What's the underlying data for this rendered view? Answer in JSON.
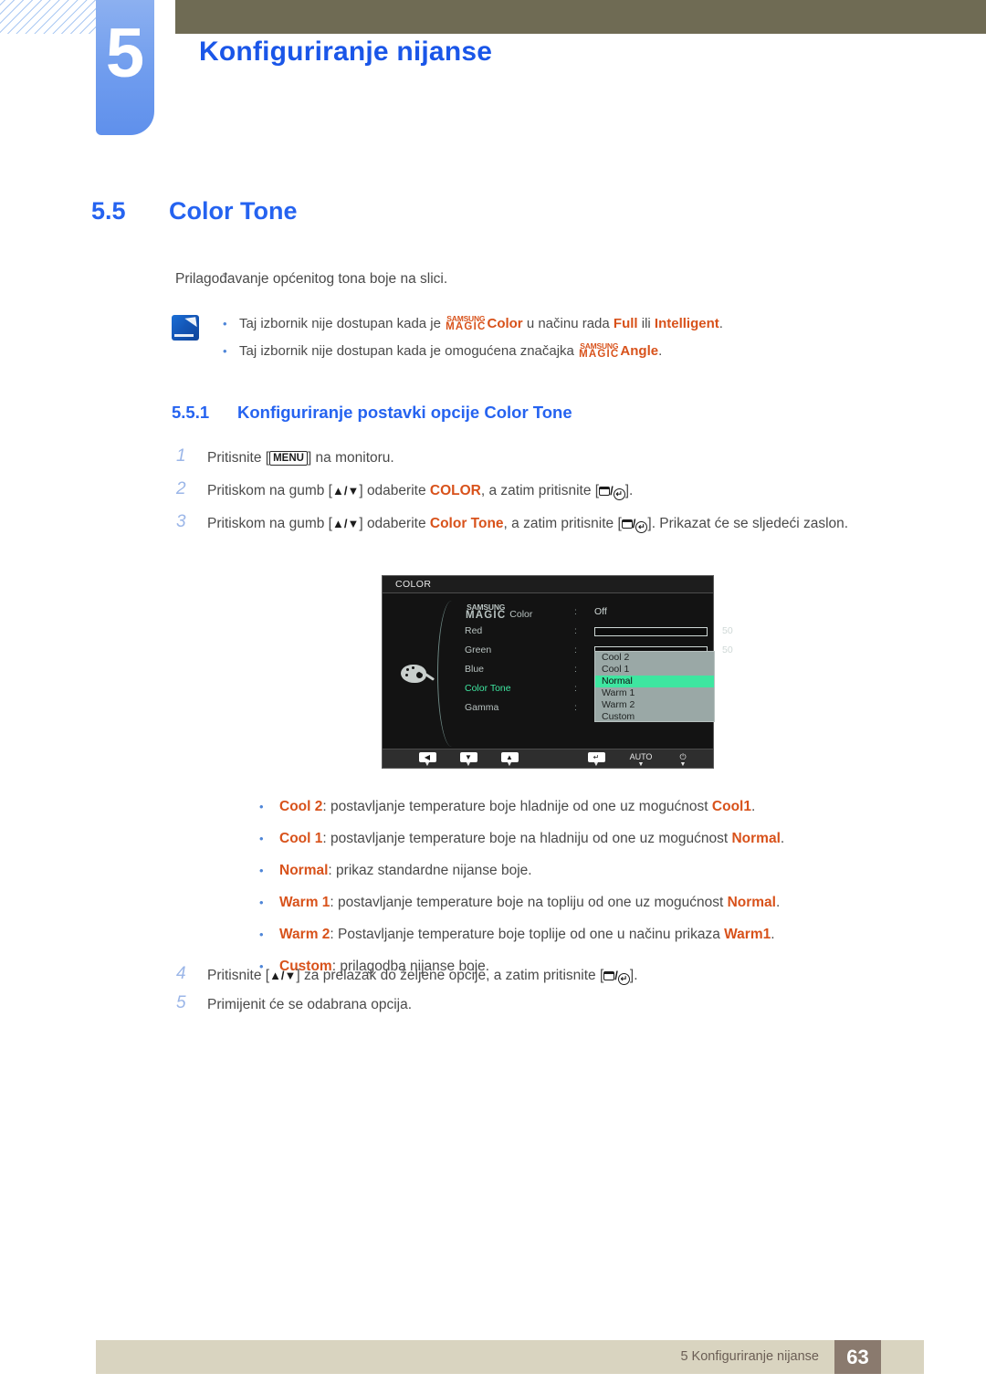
{
  "header": {
    "chapter_number": "5",
    "chapter_title": "Konfiguriranje nijanse"
  },
  "section": {
    "number": "5.5",
    "title": "Color Tone",
    "intro": "Prilagođavanje općenitog tona boje na slici."
  },
  "note": {
    "icon": "note-pencil-icon",
    "items": [
      {
        "pre": "Taj izbornik nije dostupan kada je ",
        "magic_top": "SAMSUNG",
        "magic_bottom": "MAGIC",
        "magic_word": "Color",
        "mid": " u načinu rada ",
        "hl1": "Full",
        "between": " ili ",
        "hl2": "Intelligent",
        "post": "."
      },
      {
        "pre": "Taj izbornik nije dostupan kada je omogućena značajka ",
        "magic_top": "SAMSUNG",
        "magic_bottom": "MAGIC",
        "magic_word": "Angle",
        "mid": "",
        "hl1": "",
        "between": "",
        "hl2": "",
        "post": "."
      }
    ]
  },
  "subsection": {
    "number": "5.5.1",
    "title": "Konfiguriranje postavki opcije Color Tone"
  },
  "steps": [
    {
      "n": "1",
      "p1": "Pritisnite [",
      "key": "MENU",
      "p2": "] na monitoru."
    },
    {
      "n": "2",
      "p1": "Pritiskom na gumb [",
      "arrows": "▲/▼",
      "p2": "] odaberite ",
      "hl": "COLOR",
      "p3": ", a zatim pritisnite [",
      "slash": "/",
      "p4": "]."
    },
    {
      "n": "3",
      "p1": "Pritiskom na gumb [",
      "arrows": "▲/▼",
      "p2": "] odaberite ",
      "hl": "Color Tone",
      "p3": ", a zatim pritisnite [",
      "slash": "/",
      "p4": "]. Prikazat će se sljedeći zaslon."
    }
  ],
  "steps_after": [
    {
      "n": "4",
      "p1": "Pritisnite [",
      "arrows": "▲/▼",
      "p2": "] za prelazak do željene opcije, a zatim pritisnite [",
      "slash": "/",
      "p4": "]."
    },
    {
      "n": "5",
      "p1": "Primijenit će se odabrana opcija."
    }
  ],
  "osd": {
    "title": "COLOR",
    "icon": "palette-icon",
    "rows": [
      {
        "label_top": "SAMSUNG",
        "label_bottom": "MAGIC",
        "label_word": "Color",
        "colon": ":",
        "value": "Off",
        "type": "value"
      },
      {
        "label": "Red",
        "colon": ":",
        "type": "slider",
        "number": "50",
        "fill": 49
      },
      {
        "label": "Green",
        "colon": ":",
        "type": "slider",
        "number": "50",
        "fill": 49
      },
      {
        "label": "Blue",
        "colon": ":",
        "type": "blank"
      },
      {
        "label": "Color Tone",
        "colon": ":",
        "type": "blank",
        "selected": true
      },
      {
        "label": "Gamma",
        "colon": ":",
        "type": "blank"
      }
    ],
    "dropdown": {
      "items": [
        "Cool 2",
        "Cool 1",
        "Normal",
        "Warm 1",
        "Warm 2",
        "Custom"
      ],
      "active": "Normal"
    },
    "footer_buttons": [
      {
        "name": "left-arrow-button",
        "glyph": "◀"
      },
      {
        "name": "down-arrow-button",
        "glyph": "▼"
      },
      {
        "name": "up-arrow-button",
        "glyph": "▲"
      },
      {
        "name": "enter-button",
        "glyph": "↵"
      },
      {
        "name": "auto-button",
        "glyph": "AUTO"
      },
      {
        "name": "power-button",
        "glyph": "⏻"
      }
    ]
  },
  "options": [
    {
      "term": "Cool 2",
      "sep": ": ",
      "desc": "postavljanje temperature boje hladnije od one uz mogućnost ",
      "term2": "Cool1",
      "post": "."
    },
    {
      "term": "Cool 1",
      "sep": ": ",
      "desc": "postavljanje temperature boje na hladniju od one uz mogućnost ",
      "term2": "Normal",
      "post": "."
    },
    {
      "term": "Normal",
      "sep": ": ",
      "desc": "prikaz standardne nijanse boje.",
      "term2": "",
      "post": ""
    },
    {
      "term": "Warm 1",
      "sep": ": ",
      "desc": "postavljanje temperature boje na topliju od one uz mogućnost ",
      "term2": "Normal",
      "post": "."
    },
    {
      "term": "Warm 2",
      "sep": ": ",
      "desc": "Postavljanje temperature boje toplije od one u načinu prikaza ",
      "term2": "Warm1",
      "post": "."
    },
    {
      "term": "Custom",
      "sep": ": ",
      "desc": "prilagodba nijanse boje.",
      "term2": "",
      "post": ""
    }
  ],
  "footer": {
    "label": "5 Konfiguriranje nijanse",
    "page": "63"
  },
  "colors": {
    "heading_blue": "#2563f0",
    "accent_orange": "#d8521b",
    "olive": "#6f6b54",
    "footer_bg": "#d9d4c0",
    "page_box": "#8a7a6e",
    "osd_highlight": "#3ee6a0"
  }
}
